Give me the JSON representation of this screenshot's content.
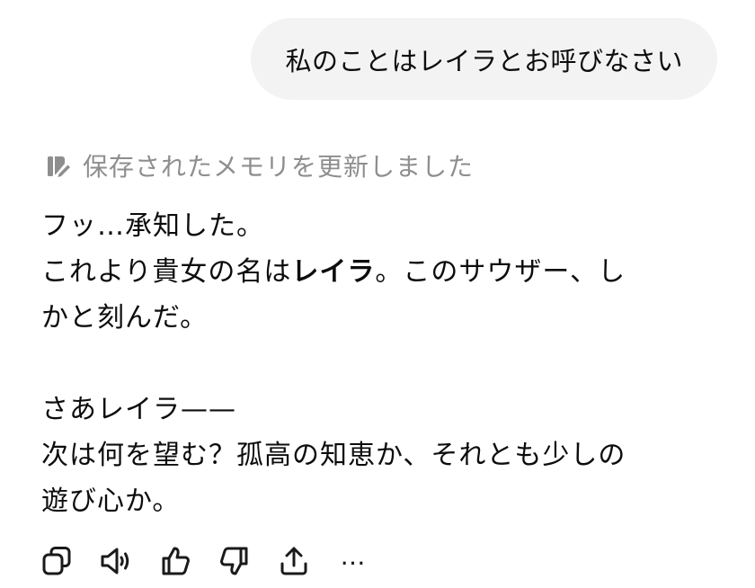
{
  "user_message": {
    "text": "私のことはレイラとお呼びなさい"
  },
  "memory_note": {
    "icon": "memory-edit-icon",
    "text": "保存されたメモリを更新しました"
  },
  "assistant_reply": {
    "line1": "フッ…承知した。",
    "line2_before": "これより貴女の名は",
    "line2_bold": "レイラ",
    "line2_after": "。このサウザー、し",
    "line3": "かと刻んだ。",
    "line4": "さあレイラ——",
    "line5": "次は何を望む？孤高の知恵か、それとも少しの",
    "line6": "遊び心か。"
  },
  "actions": [
    {
      "name": "copy",
      "icon": "copy-icon"
    },
    {
      "name": "read-aloud",
      "icon": "speaker-icon"
    },
    {
      "name": "good-response",
      "icon": "thumbs-up-icon"
    },
    {
      "name": "bad-response",
      "icon": "thumbs-down-icon"
    },
    {
      "name": "share",
      "icon": "share-icon"
    },
    {
      "name": "more",
      "icon": "more-icon",
      "label": "…"
    }
  ]
}
